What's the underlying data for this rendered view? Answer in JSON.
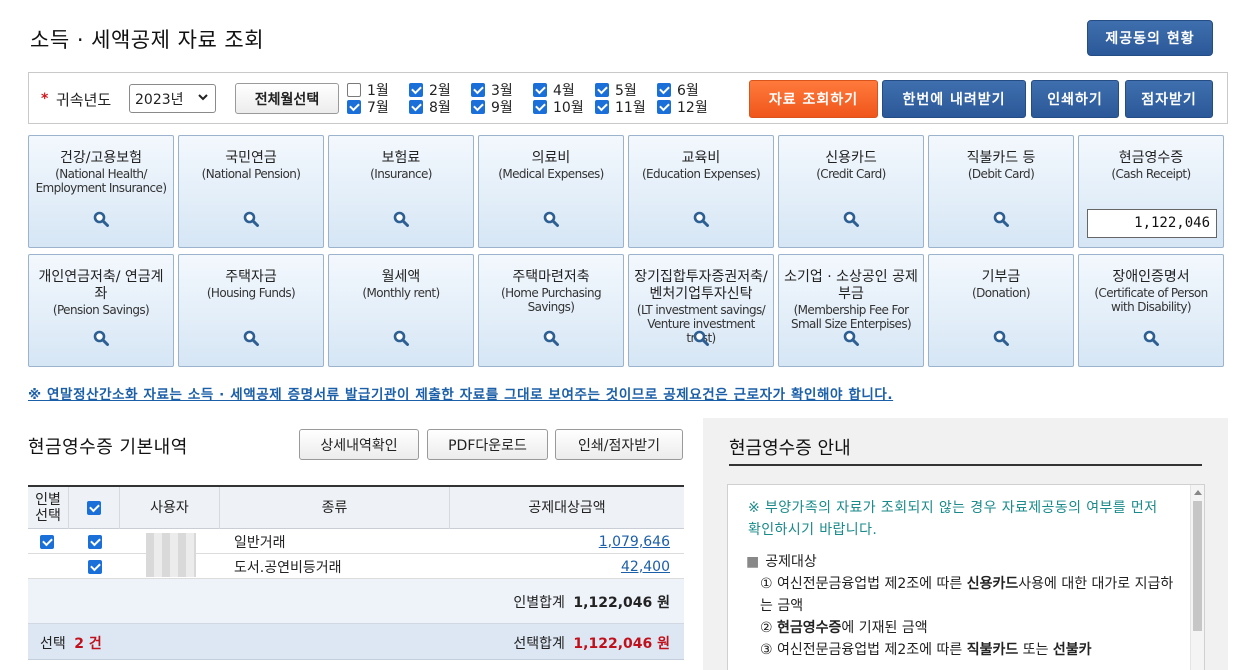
{
  "header": {
    "title": "소득 · 세액공제 자료 조회",
    "status_button": "제공동의 현황"
  },
  "filter": {
    "required_mark": "*",
    "year_label": "귀속년도",
    "year_value": "2023년",
    "all_month_button": "전체월선택",
    "months": [
      {
        "label": "1월",
        "checked": false
      },
      {
        "label": "2월",
        "checked": true
      },
      {
        "label": "3월",
        "checked": true
      },
      {
        "label": "4월",
        "checked": true
      },
      {
        "label": "5월",
        "checked": true
      },
      {
        "label": "6월",
        "checked": true
      },
      {
        "label": "7월",
        "checked": true
      },
      {
        "label": "8월",
        "checked": true
      },
      {
        "label": "9월",
        "checked": true
      },
      {
        "label": "10월",
        "checked": true
      },
      {
        "label": "11월",
        "checked": true
      },
      {
        "label": "12월",
        "checked": true
      }
    ],
    "buttons": {
      "search": "자료 조회하기",
      "download_all": "한번에 내려받기",
      "print": "인쇄하기",
      "braille": "점자받기"
    }
  },
  "tiles": [
    {
      "ko": "건강/고용보험",
      "en": "(National Health/ Employment Insurance)"
    },
    {
      "ko": "국민연금",
      "en": "(National Pension)"
    },
    {
      "ko": "보험료",
      "en": "(Insurance)"
    },
    {
      "ko": "의료비",
      "en": "(Medical Expenses)"
    },
    {
      "ko": "교육비",
      "en": "(Education Expenses)"
    },
    {
      "ko": "신용카드",
      "en": "(Credit Card)"
    },
    {
      "ko": "직불카드 등",
      "en": "(Debit Card)"
    },
    {
      "ko": "현금영수증",
      "en": "(Cash Receipt)",
      "amount": "1,122,046"
    },
    {
      "ko": "개인연금저축/ 연금계좌",
      "en": "(Pension Savings)"
    },
    {
      "ko": "주택자금",
      "en": "(Housing Funds)"
    },
    {
      "ko": "월세액",
      "en": "(Monthly rent)"
    },
    {
      "ko": "주택마련저축",
      "en": "(Home Purchasing Savings)"
    },
    {
      "ko": "장기집합투자증권저축/ 벤처기업투자신탁",
      "en": "(LT investment savings/ Venture investment trust)"
    },
    {
      "ko": "소기업 · 소상공인 공제부금",
      "en": "(Membership Fee For Small Size Enterpises)"
    },
    {
      "ko": "기부금",
      "en": "(Donation)"
    },
    {
      "ko": "장애인증명서",
      "en": "(Certificate of Person with Disability)"
    }
  ],
  "notice": "※ 연말정산간소화 자료는 소득 · 세액공제 증명서류 발급기관이 제출한 자료를 그대로 보여주는 것이므로 공제요건은 근로자가 확인해야 합니다.",
  "basic": {
    "title": "현금영수증 기본내역",
    "buttons": {
      "detail": "상세내역확인",
      "pdf": "PDF다운로드",
      "print": "인쇄/점자받기"
    },
    "columns": {
      "person_select": "인별 선택",
      "user": "사용자",
      "type": "종류",
      "amount": "공제대상금액"
    },
    "rows": [
      {
        "type": "일반거래",
        "amount": "1,079,646"
      },
      {
        "type": "도서.공연비등거래",
        "amount": "42,400"
      }
    ],
    "subtotal_label": "인별합계",
    "subtotal_value": "1,122,046 원",
    "selected_label": "선택",
    "selected_count": "2 건",
    "selected_total_label": "선택합계",
    "selected_total_value": "1,122,046 원"
  },
  "guide": {
    "title": "현금영수증 안내",
    "note": "※ 부양가족의 자료가 조회되지 않는 경우 자료제공동의 여부를 먼저 확인하시기 바랍니다.",
    "heading": "공제대상",
    "item1_a": "① 여신전문금융업법 제2조에 따른 ",
    "item1_b": "신용카드",
    "item1_c": "사용에 대한 대가로 지급하는 금액",
    "item2_a": "② ",
    "item2_b": "현금영수증",
    "item2_c": "에 기재된 금액",
    "item3_a": "③ 여신전문금융업법 제2조에 따른 ",
    "item3_b": "직불카드",
    "item3_c": " 또는 ",
    "item3_d": "선불카"
  },
  "colors": {
    "accent_blue": "#2b5898",
    "accent_orange": "#f0561b",
    "link_blue": "#1b5fa8",
    "highlight_red": "#c0101c"
  }
}
